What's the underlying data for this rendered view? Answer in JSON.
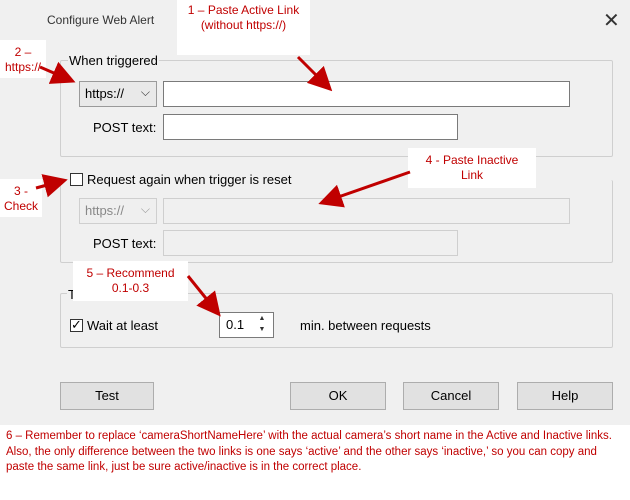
{
  "window": {
    "title": "Configure Web Alert",
    "close_glyph": "✕"
  },
  "when_triggered": {
    "group_label": "When triggered",
    "protocol": "https://",
    "url_value": "",
    "post_label": "POST text:",
    "post_value": ""
  },
  "reset": {
    "checkbox_label": "Request again when trigger is reset",
    "checked": false,
    "protocol": "https://",
    "url_value": "",
    "post_label": "POST text:",
    "post_value": ""
  },
  "timing": {
    "group_label": "T",
    "wait_label": "Wait at least",
    "wait_checked": true,
    "wait_value": "0.1",
    "suffix": "min. between requests"
  },
  "buttons": {
    "test": "Test",
    "ok": "OK",
    "cancel": "Cancel",
    "help": "Help"
  },
  "annotations": {
    "a1": "1 – Paste Active Link (without https://)",
    "a2": "2 – https://",
    "a3": "3 - Check",
    "a4": "4 - Paste Inactive Link",
    "a5": "5 – Recommend 0.1-0.3",
    "a6": "6 – Remember to replace ‘cameraShortNameHere’ with the actual camera’s short name in the Active and Inactive links.  Also, the only difference between the two links is one says ‘active’ and the other says ‘inactive,’ so you can copy and paste the same link, just be sure active/inactive is in the correct place."
  },
  "colors": {
    "annotation": "#c00000",
    "dialog_bg": "#f0f0f0"
  }
}
